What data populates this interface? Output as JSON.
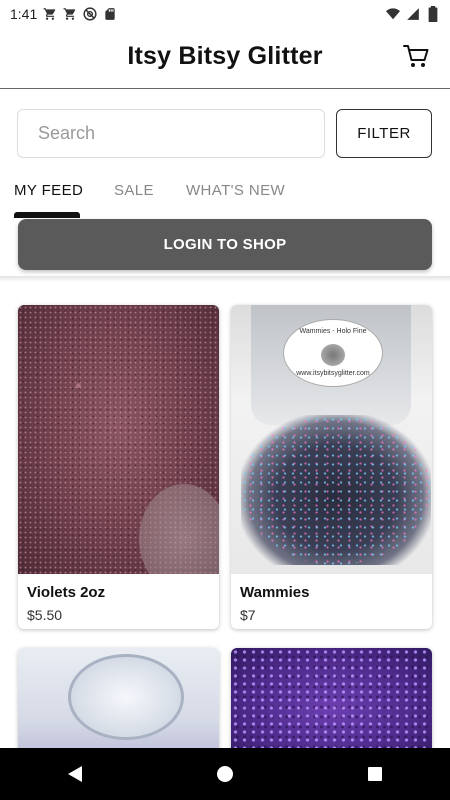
{
  "status_bar": {
    "time": "1:41",
    "left_icons": [
      "cart-notification-icon",
      "cart-notification-icon",
      "at-sign-icon",
      "sd-card-icon"
    ],
    "right_icons": [
      "wifi-icon",
      "signal-icon",
      "battery-icon"
    ]
  },
  "header": {
    "title": "Itsy Bitsy Glitter",
    "cart_icon": "shopping-cart-icon"
  },
  "search": {
    "placeholder": "Search",
    "value": ""
  },
  "filter": {
    "label": "FILTER"
  },
  "tabs": [
    {
      "label": "MY FEED",
      "active": true
    },
    {
      "label": "SALE",
      "active": false
    },
    {
      "label": "WHAT'S NEW",
      "active": false
    }
  ],
  "login_banner": {
    "label": "LOGIN TO SHOP",
    "color": "#5a5a5a"
  },
  "products": [
    {
      "name": "Violets 2oz",
      "price": "$5.50",
      "image": "rose-purple-fine-glitter"
    },
    {
      "name": "Wammies",
      "price": "$7",
      "image": "holographic-chunky-glitter-bag",
      "image_text": [
        "Wammies - Holo Fine",
        "www.itsybitsyglitter.com"
      ]
    },
    {
      "name": "",
      "price": "",
      "image": "clear-holographic-glitter-jar"
    },
    {
      "name": "",
      "price": "",
      "image": "purple-holographic-glitter"
    }
  ],
  "nav_bar": {
    "icons": [
      "back-icon",
      "home-icon",
      "recents-icon"
    ]
  }
}
